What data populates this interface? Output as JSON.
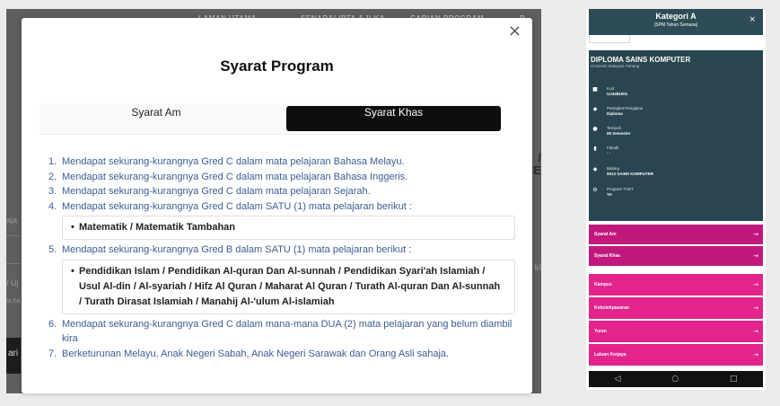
{
  "background_page": {
    "nav_items": [
      "LAMAN UTAMA",
      "SENARAI IPTA & ILKA",
      "CARIAN PROGRAM",
      "P"
    ],
    "side_fragments": [
      "aja",
      "/ Uj",
      "ta ha",
      "ari"
    ],
    "right_fragments": [
      "/",
      "ME",
      "kl"
    ]
  },
  "modal": {
    "close_label": "×",
    "title": "Syarat Program",
    "tabs": [
      {
        "label": "Syarat Am",
        "active": false
      },
      {
        "label": "Syarat Khas",
        "active": true
      }
    ],
    "requirements": [
      {
        "num": "1.",
        "text": "Mendapat sekurang-kurangnya Gred C dalam mata pelajaran Bahasa Melayu."
      },
      {
        "num": "2.",
        "text": "Mendapat sekurang-kurangnya Gred C dalam mata pelajaran Bahasa Inggeris."
      },
      {
        "num": "3.",
        "text": "Mendapat sekurang-kurangnya Gred C dalam mata pelajaran Sejarah."
      },
      {
        "num": "4.",
        "text": "Mendapat sekurang-kurangnya Gred C dalam SATU (1) mata pelajaran berikut :",
        "subjects": "Matematik / Matematik Tambahan"
      },
      {
        "num": "5.",
        "text": "Mendapat sekurang-kurangnya Gred B dalam SATU (1) mata pelajaran berikut :",
        "subjects": "Pendidikan Islam / Pendidikan Al-quran Dan Al-sunnah / Pendidikan Syari'ah Islamiah / Usul Al-din / Al-syariah / Hifz Al Quran / Maharat Al Quran / Turath Al-quran Dan Al-sunnah / Turath Dirasat Islamiah / Manahij Al-'ulum Al-islamiah"
      },
      {
        "num": "6.",
        "text": "Mendapat sekurang-kurangnya Gred C dalam mana-mana DUA (2) mata pelajaran yang belum diambil kira"
      },
      {
        "num": "7.",
        "text": "Berketurunan Melayu, Anak Negeri Sabah, Anak Negeri Sarawak dan Orang Asli sahaja."
      }
    ]
  },
  "phone": {
    "header_title": "Kategori A",
    "header_subtitle": "(SPM Tahun Semasa)",
    "close_label": "×",
    "program_name": "DIPLOMA SAINS KOMPUTER",
    "university": "Universiti Malaysia Pahang",
    "details": [
      {
        "icon": "bookmark-icon",
        "glyph": "■",
        "label": "Kod",
        "value": "UJ4481001"
      },
      {
        "icon": "graduation-cap-icon",
        "glyph": "◆",
        "label": "Peringkat Pengajian",
        "value": "Diploma"
      },
      {
        "icon": "clock-icon",
        "glyph": "●",
        "label": "Tempoh",
        "value": "06 Semester"
      },
      {
        "icon": "building-icon",
        "glyph": "▮",
        "label": "Fakulti",
        "value": "- -"
      },
      {
        "icon": "book-icon",
        "glyph": "◆",
        "label": "Bidang",
        "value": "0613 SAINS KOMPUTER"
      },
      {
        "icon": "gear-icon",
        "glyph": "⚙",
        "label": "Program TVET",
        "value": "YA"
      }
    ],
    "menu": [
      {
        "label": "Syarat Am",
        "arrow": "→"
      },
      {
        "label": "Syarat Khas",
        "arrow": "→"
      },
      {
        "label": "Kampus",
        "arrow": "→"
      },
      {
        "label": "Kebolehpasaran",
        "arrow": "→"
      },
      {
        "label": "Yuran",
        "arrow": "→"
      },
      {
        "label": "Laluan Kerjaya",
        "arrow": "→"
      }
    ],
    "nav": {
      "back": "◁",
      "home": "○",
      "recent": "□"
    },
    "colors": {
      "header": "#2e4c55",
      "body": "#294550",
      "menu_pink": "#e2248c",
      "menu_pink_dark": "#c2187d"
    }
  }
}
